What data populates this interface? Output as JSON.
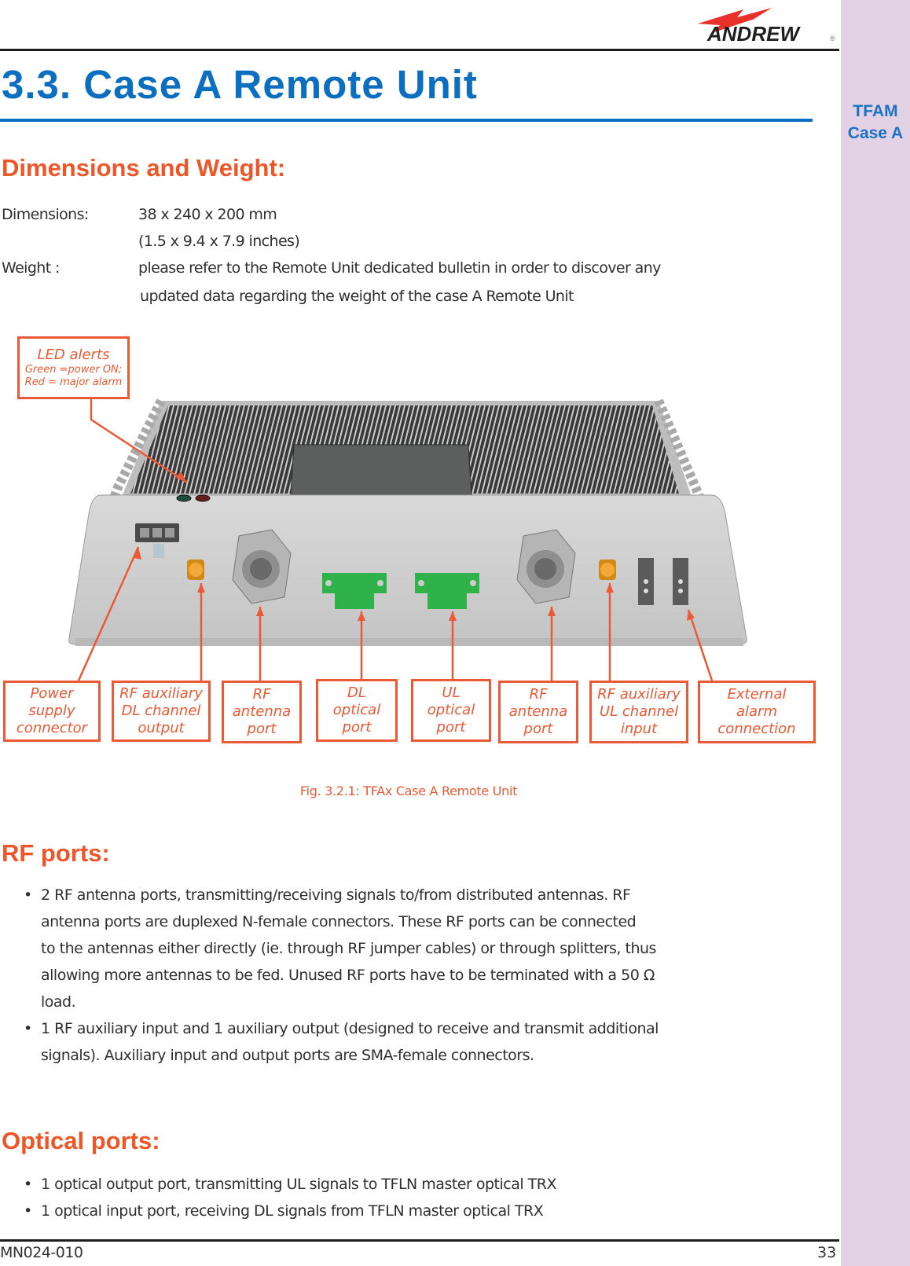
{
  "brand": {
    "logo_text": "ANDREW",
    "logo_mark": "®"
  },
  "sidebar": {
    "line1": "TFAM",
    "line2": "Case A",
    "color": "#e3d1e6"
  },
  "title": "3.3. Case A Remote Unit",
  "dimensions_section": {
    "heading": "Dimensions and Weight:",
    "dimensions_label": "Dimensions:",
    "dimensions_value": "38 x 240 x 200 mm",
    "dimensions_value_inches": "(1.5 x 9.4 x 7.9 inches)",
    "weight_label": "Weight :",
    "weight_line1": "please refer to the Remote Unit dedicated bulletin in order to discover any",
    "weight_line2": "updated data regarding the weight of the case A Remote Unit"
  },
  "figure": {
    "led_callout": {
      "title": "LED alerts",
      "line1": "Green =power ON;",
      "line2": "Red = major alarm"
    },
    "callouts": [
      {
        "lines": [
          "Power",
          "supply",
          "connector"
        ]
      },
      {
        "lines": [
          "RF auxiliary",
          "DL channel",
          "output"
        ]
      },
      {
        "lines": [
          "RF",
          "antenna",
          "port"
        ]
      },
      {
        "lines": [
          "DL",
          "optical",
          "port"
        ]
      },
      {
        "lines": [
          "UL",
          "optical",
          "port"
        ]
      },
      {
        "lines": [
          "RF",
          "antenna",
          "port"
        ]
      },
      {
        "lines": [
          "RF auxiliary",
          "UL channel",
          "input"
        ]
      },
      {
        "lines": [
          "External",
          "alarm",
          "connection"
        ]
      }
    ],
    "caption": "Fig. 3.2.1: TFAx Case A Remote Unit"
  },
  "rf_section": {
    "heading": "RF ports:",
    "bullets": [
      {
        "lines": [
          "2 RF antenna ports, transmitting/receiving signals to/from distributed antennas. RF",
          "antenna ports are duplexed N-female connectors. These RF ports can be connected",
          "to the antennas either directly (ie. through RF jumper cables) or through splitters, thus",
          "allowing more antennas to be fed. Unused RF ports have to be terminated with a 50 Ω",
          "load."
        ]
      },
      {
        "lines": [
          "1 RF auxiliary input and 1 auxiliary output (designed to receive and transmit additional",
          "signals). Auxiliary input and output ports are SMA-female connectors."
        ]
      }
    ]
  },
  "optical_section": {
    "heading": "Optical ports:",
    "bullets": [
      "1 optical output port, transmitting UL signals to TFLN master optical TRX",
      "1 optical input port, receiving DL signals from TFLN master optical TRX"
    ]
  },
  "footer": {
    "doc_id": "MN024-010",
    "page_number": "33"
  },
  "colors": {
    "title_blue": "#0c6ebf",
    "heading_orange": "#ee5528",
    "callout_orange": "#ea5a36"
  },
  "bullet_glyph": "•"
}
